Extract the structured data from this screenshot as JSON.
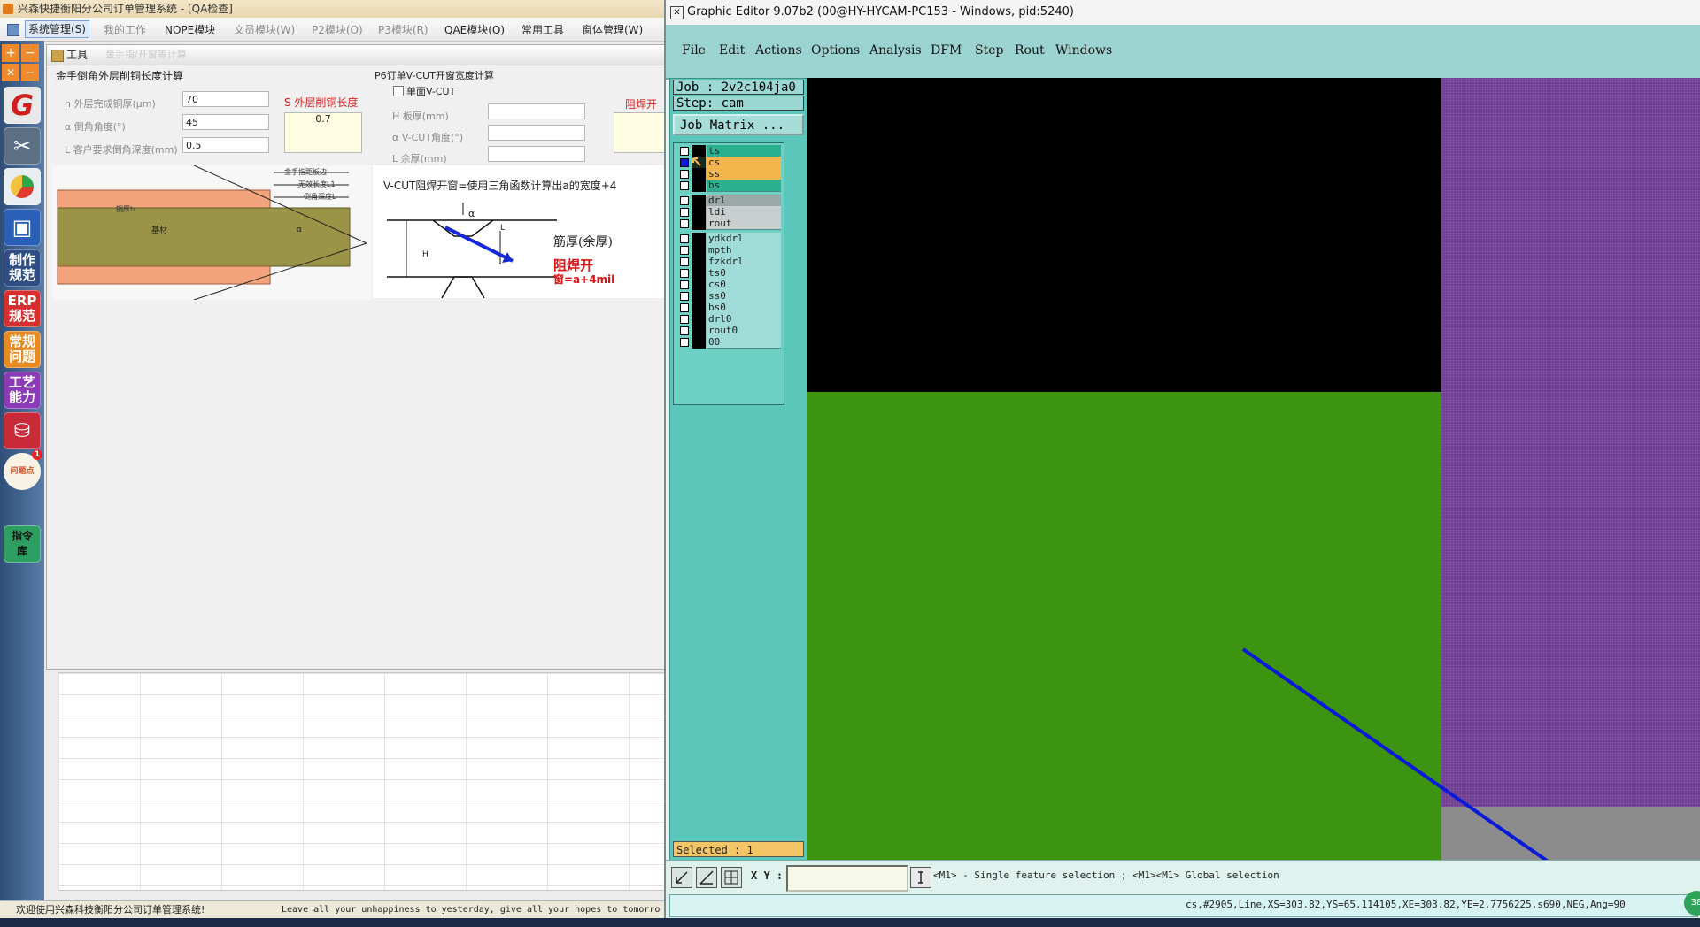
{
  "left_app": {
    "title": "兴森快捷衡阳分公司订单管理系统 - [QA检查]",
    "menu": [
      "系统管理(S)",
      "我的工作",
      "NOPE模块",
      "文员模块(W)",
      "P2模块(O)",
      "P3模块(R)",
      "QAE模块(Q)",
      "常用工具",
      "窗体管理(W)"
    ],
    "sidebar": [
      "制作规范",
      "ERP规范",
      "常规问题",
      "工艺能力",
      "指令库"
    ],
    "sidebar_badge": "1",
    "sidebar_issue_label": "问题点",
    "tool_window_title": "工具",
    "tool_window_subtitle": "金手指/开窗等计算",
    "gold_finger": {
      "title": "金手倒角外层削铜长度计算",
      "fields": [
        {
          "label": "h 外层完成铜厚(μm)",
          "value": "70"
        },
        {
          "label": "α 倒角角度(°)",
          "value": "45"
        },
        {
          "label": "L 客户要求倒角深度(mm)",
          "value": "0.5"
        }
      ],
      "result_label": "S 外层削铜长度",
      "result_value": "0.7",
      "diagram_labels": [
        "金手指距板边",
        "无效长度L1",
        "倒角深度L",
        "铜厚h",
        "基材",
        "α"
      ]
    },
    "vcut": {
      "title": "P6订单V-CUT开窗宽度计算",
      "checkbox_label": "单面V-CUT",
      "fields": [
        {
          "label": "H 板厚(mm)",
          "value": ""
        },
        {
          "label": "α V-CUT角度(°)",
          "value": ""
        },
        {
          "label": "L 余厚(mm)",
          "value": ""
        }
      ],
      "result_label": "阻焊开",
      "description": "V-CUT阻焊开窗=使用三角函数计算出a的宽度+4",
      "diagram_labels": [
        "α",
        "L",
        "H",
        "筋厚(余厚)",
        "阻焊开",
        "窗=a+4mil"
      ]
    },
    "status_left": "欢迎使用兴森科技衡阳分公司订单管理系统!",
    "status_marquee": "Leave all your unhappiness to yesterday, give all your hopes to tomorro"
  },
  "ge": {
    "title": "Graphic Editor 9.07b2 (00@HY-HYCAM-PC153 - Windows, pid:5240)",
    "menu": [
      "File",
      "Edit",
      "Actions",
      "Options",
      "Analysis",
      "DFM",
      "Step",
      "Rout",
      "Windows"
    ],
    "job": "Job : 2v2c104ja0",
    "step": "Step: cam",
    "job_matrix": "Job Matrix ...",
    "layer_groups": [
      [
        {
          "name": "ts",
          "color": "#2bb08f",
          "active": false
        },
        {
          "name": "cs",
          "color": "#f4b54c",
          "active": true
        },
        {
          "name": "ss",
          "color": "#f4b54c",
          "active": false
        },
        {
          "name": "bs",
          "color": "#2bb08f",
          "active": false
        }
      ],
      [
        {
          "name": "drl",
          "color": "#9aa8a8",
          "active": false
        },
        {
          "name": "ldi",
          "color": "#c9cfcf",
          "active": false
        },
        {
          "name": "rout",
          "color": "#c9cfcf",
          "active": false
        }
      ],
      [
        {
          "name": "ydkdrl",
          "color": "#9fdcd8",
          "active": false
        },
        {
          "name": "mpth",
          "color": "#9fdcd8",
          "active": false
        },
        {
          "name": "fzkdrl",
          "color": "#9fdcd8",
          "active": false
        },
        {
          "name": "ts0",
          "color": "#9fdcd8",
          "active": false
        },
        {
          "name": "cs0",
          "color": "#9fdcd8",
          "active": false
        },
        {
          "name": "ss0",
          "color": "#9fdcd8",
          "active": false
        },
        {
          "name": "bs0",
          "color": "#9fdcd8",
          "active": false
        },
        {
          "name": "drl0",
          "color": "#9fdcd8",
          "active": false
        },
        {
          "name": "rout0",
          "color": "#9fdcd8",
          "active": false
        },
        {
          "name": "00",
          "color": "#9fdcd8",
          "active": false
        }
      ]
    ],
    "selected": "Selected : 1",
    "xy_label": "X Y :",
    "xy_value": "",
    "hint": "<M1> - Single feature selection ; <M1><M1> Global selection",
    "feature_info": "cs,#2905,Line,XS=303.82,YS=65.114105,XE=303.82,YE=2.7756225,s690,NEG,Ang=90",
    "corner_badge": "38",
    "colors": {
      "canvas_black": "#000000",
      "green_fill": "#3c9411",
      "purple_fill": "#6f3f91",
      "gray_fill": "#8c8c8c",
      "feature_line": "#0a1ad8"
    }
  }
}
